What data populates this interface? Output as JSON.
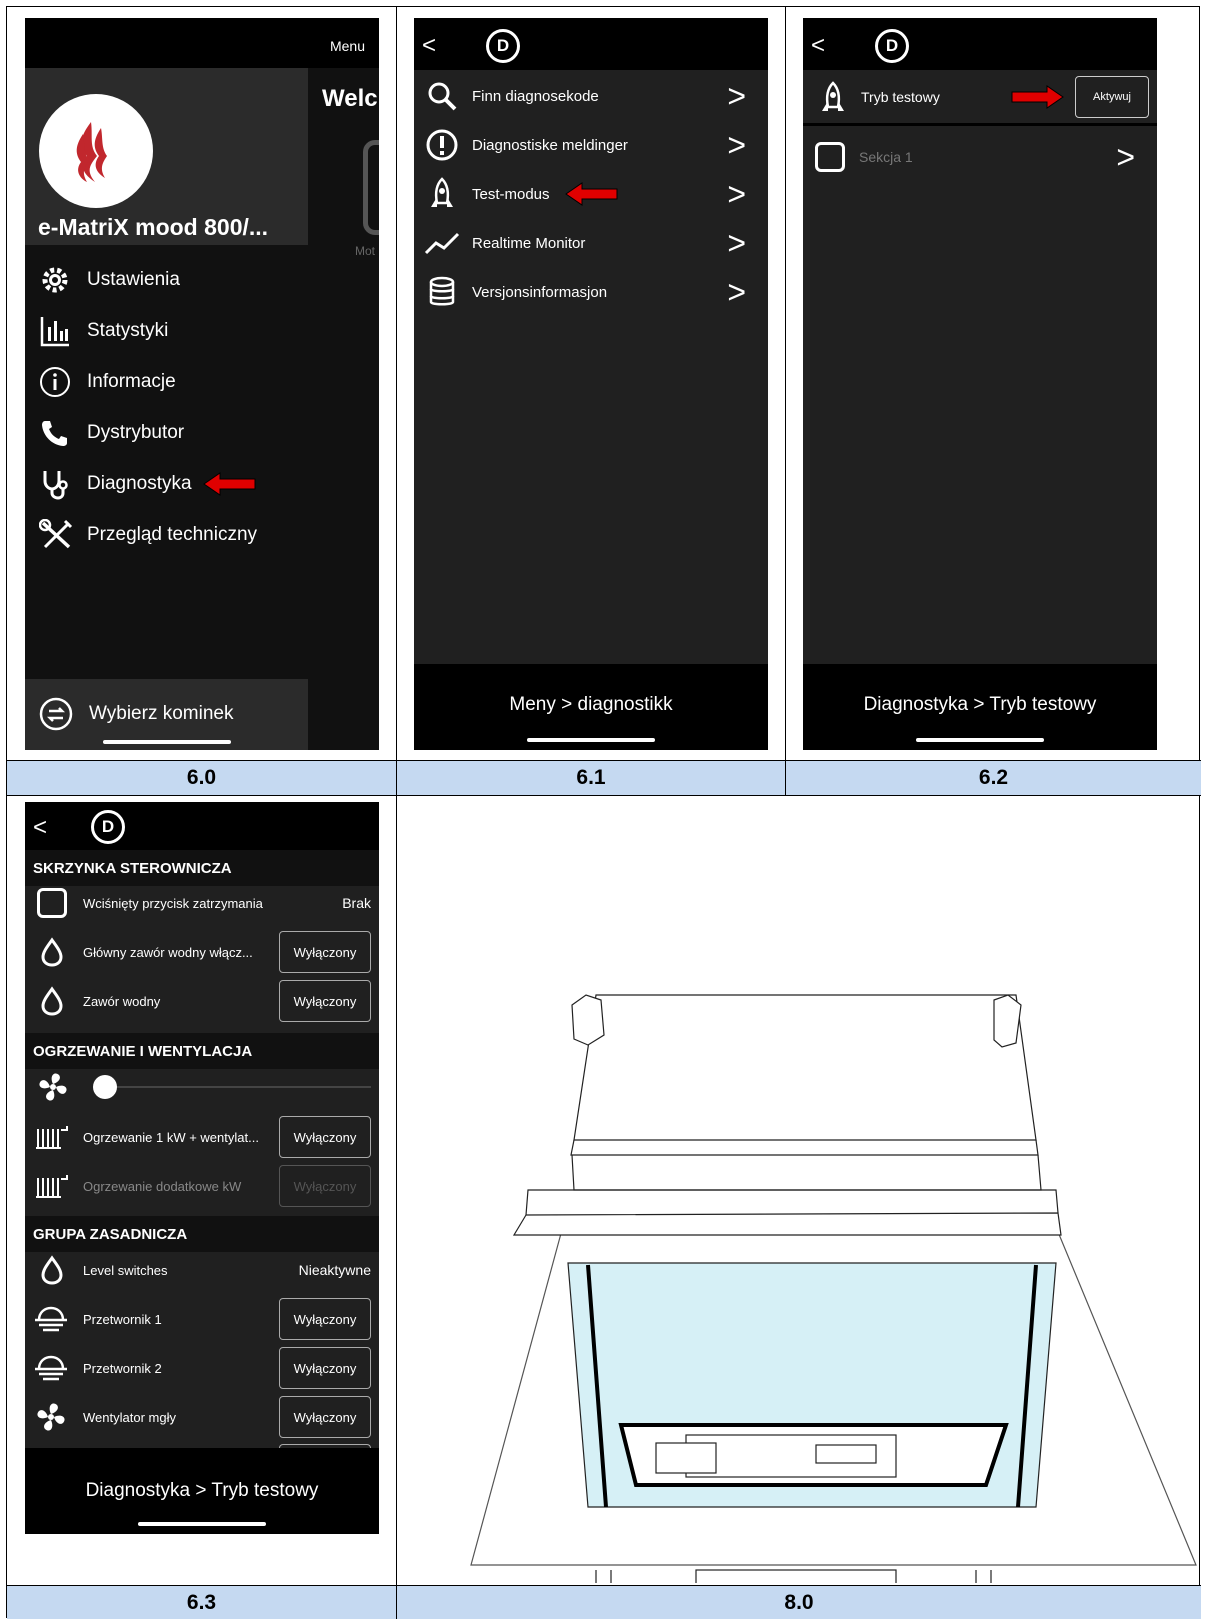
{
  "panels": {
    "p60": {
      "caption": "6.0",
      "menu_label": "Menu",
      "welcome_text": "Welc",
      "side_label": "Mot",
      "device_name": "e-MatriX mood 800/...",
      "items": [
        {
          "label": "Ustawienia",
          "icon": "gear-icon"
        },
        {
          "label": "Statystyki",
          "icon": "bar-chart-icon"
        },
        {
          "label": "Informacje",
          "icon": "info-icon"
        },
        {
          "label": "Dystrybutor",
          "icon": "phone-icon"
        },
        {
          "label": "Diagnostyka",
          "icon": "stethoscope-icon"
        },
        {
          "label": "Przegląd techniczny",
          "icon": "tools-icon"
        }
      ],
      "bottom_label": "Wybierz kominek"
    },
    "p61": {
      "caption": "6.1",
      "items": [
        {
          "label": "Finn diagnosekode",
          "icon": "search-icon"
        },
        {
          "label": "Diagnostiske meldinger",
          "icon": "alert-icon"
        },
        {
          "label": "Test-modus",
          "icon": "rocket-icon"
        },
        {
          "label": "Realtime Monitor",
          "icon": "trend-icon"
        },
        {
          "label": "Versjonsinformasjon",
          "icon": "database-icon"
        }
      ],
      "breadcrumb": "Meny > diagnostikk"
    },
    "p62": {
      "caption": "6.2",
      "test_mode_label": "Tryb testowy",
      "activate_label": "Aktywuj",
      "section_label": "Sekcja 1",
      "breadcrumb": "Diagnostyka > Tryb testowy"
    },
    "p63": {
      "caption": "6.3",
      "sections": [
        {
          "title": "SKRZYNKA STEROWNICZA"
        },
        {
          "title": "OGRZEWANIE I WENTYLACJA"
        },
        {
          "title": "GRUPA ZASADNICZA"
        }
      ],
      "stop_button_label": "Wciśnięty przycisk zatrzymania",
      "stop_button_value": "Brak",
      "main_valve_label": "Główny zawór wodny włącz...",
      "water_valve_label": "Zawór wodny",
      "fan_level": 0,
      "heating1_label": "Ogrzewanie 1 kW + wentylat...",
      "heating_extra_label": "Ogrzewanie dodatkowe kW",
      "level_switches_label": "Level switches",
      "level_switches_value": "Nieaktywne",
      "transducer1_label": "Przetwornik 1",
      "transducer2_label": "Przetwornik 2",
      "mist_fan_label": "Wentylator mgły",
      "off_label": "Wyłączony",
      "breadcrumb": "Diagnostyka > Tryb testowy"
    },
    "p80": {
      "caption": "8.0"
    }
  },
  "colors": {
    "caption_bg": "#c5d9f1",
    "phone_bg": "#202020",
    "arrow": "#e00000",
    "glass": "#d6f0f6"
  }
}
